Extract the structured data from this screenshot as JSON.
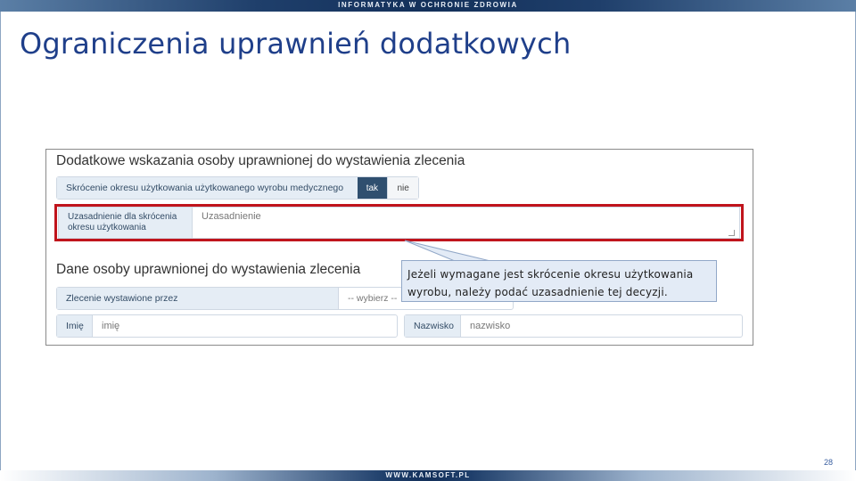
{
  "header": {
    "banner_text": "INFORMATYKA W OCHRONIE ZDROWIA",
    "title": "Ograniczenia uprawnień dodatkowych"
  },
  "footer": {
    "banner_text": "WWW.KAMSOFT.PL",
    "page_number": "28"
  },
  "screenshot": {
    "section1": {
      "heading": "Dodatkowe wskazania osoby uprawnionej do wystawienia zlecenia",
      "shortening_label": "Skrócenie okresu użytkowania użytkowanego wyrobu medycznego",
      "yes_label": "tak",
      "no_label": "nie",
      "justification_label": "Uzasadnienie dla skrócenia okresu użytkowania",
      "justification_placeholder": "Uzasadnienie"
    },
    "section2": {
      "heading": "Dane osoby uprawnionej do wystawienia zlecenia",
      "issued_by_label": "Zlecenie wystawione przez",
      "issued_by_value": "-- wybierz --",
      "first_name_label": "Imię",
      "first_name_placeholder": "imię",
      "last_name_label": "Nazwisko",
      "last_name_placeholder": "nazwisko"
    }
  },
  "callout": {
    "text": "Jeżeli wymagane jest skrócenie okresu użytkowania wyrobu, należy podać uzasadnienie tej decyzji."
  },
  "colors": {
    "title": "#1f3f8a",
    "highlight_border": "#c0141c",
    "button_selected": "#2f4f6f",
    "callout_bg": "#e3ebf6"
  }
}
